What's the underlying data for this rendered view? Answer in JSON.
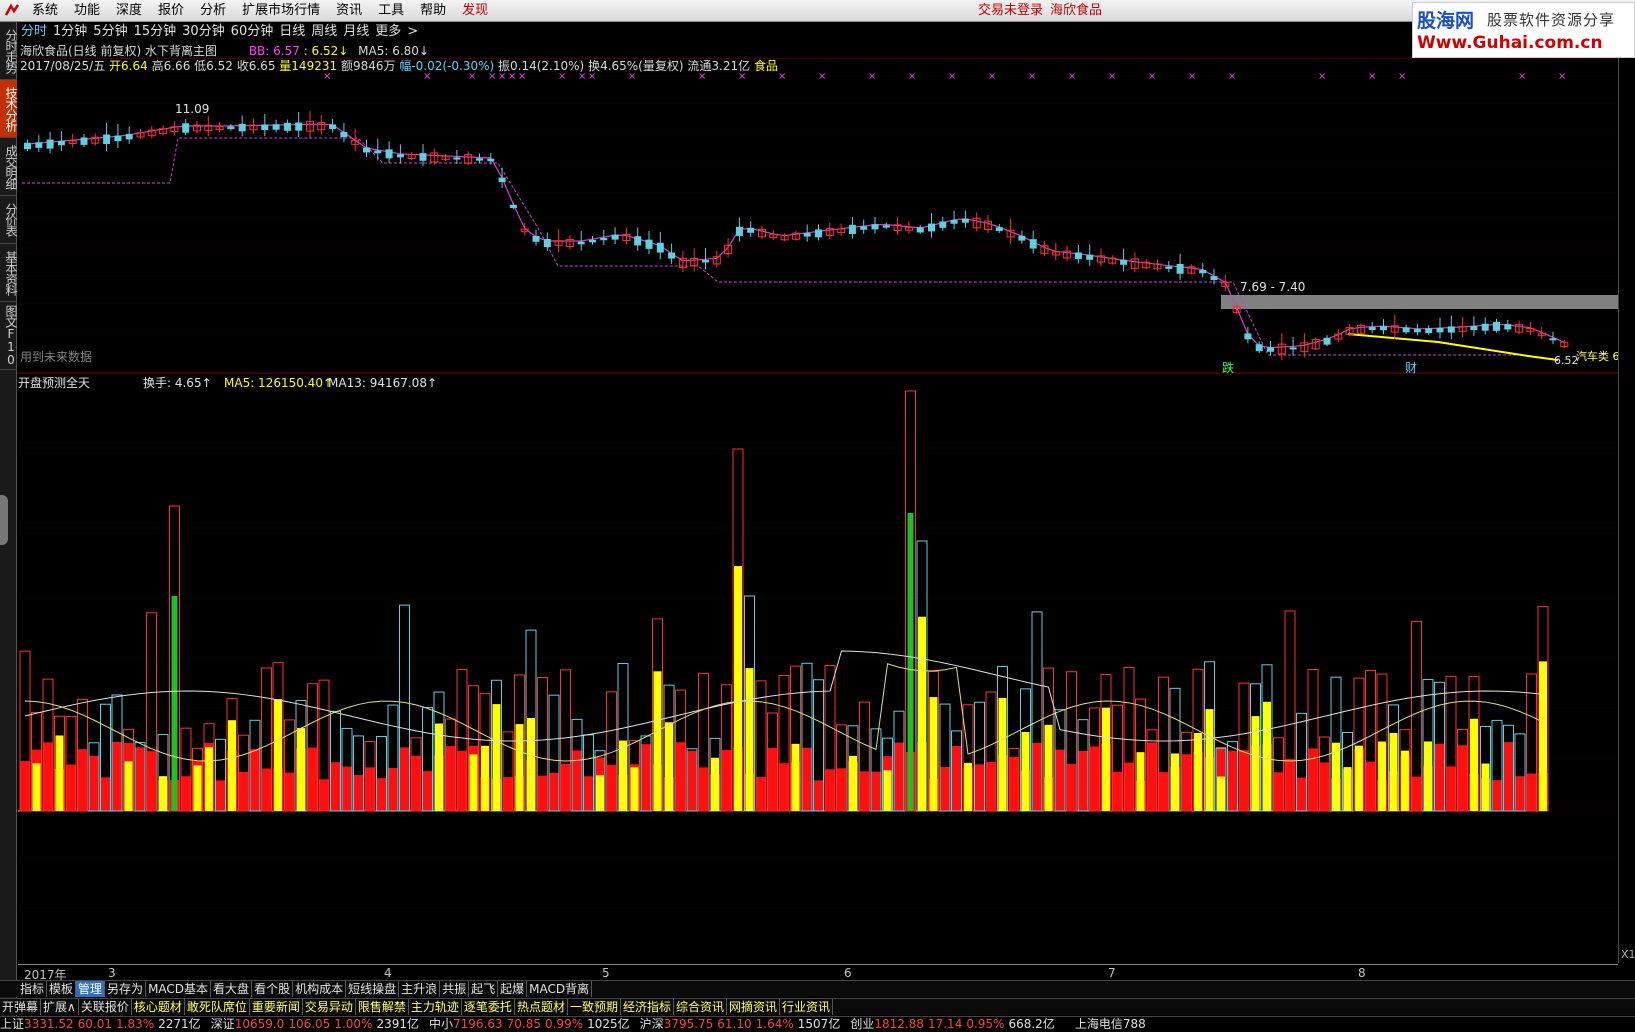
{
  "menu": {
    "items": [
      "系统",
      "功能",
      "深度",
      "报价",
      "分析",
      "扩展市场行情",
      "资讯",
      "工具",
      "帮助",
      "发现"
    ],
    "status": "交易未登录",
    "stock": "海欣食品"
  },
  "brand": {
    "name": "股海网",
    "slogan": "股票软件资源分享",
    "url": "Www.Guhai.com.cn"
  },
  "left_tabs": [
    "分时走势",
    "技术分析",
    "成交明细",
    "分价表",
    "基本资料",
    "图文F10"
  ],
  "periods": [
    "分时",
    "1分钟",
    "5分钟",
    "15分钟",
    "30分钟",
    "60分钟",
    "日线",
    "周线",
    "月线",
    "更多",
    ">"
  ],
  "title_line": {
    "title": "海欣食品(日线 前复权) 水下背离主图",
    "bb": "BB: 6.57",
    "bb2": ": 6.52↓",
    "ma5": "MA5: 6.80↓"
  },
  "quote_line": {
    "date": "2017/08/25/五",
    "open": "开6.64",
    "high": "高6.66",
    "low": "低6.52",
    "close": "收6.65",
    "vol": "量149231",
    "amount": "额9846万",
    "change": "幅-0.02(-0.30%)",
    "amplitude": "振0.14(2.10%)",
    "turnover": "换4.65%(量复权)",
    "float": "流通3.21亿",
    "industry": "食品"
  },
  "main_chart": {
    "high_label": "11.09",
    "range_label": "7.69 - 7.40",
    "low_label": "6.52",
    "sector_label": "汽车类 6",
    "future_note": "用到未来数据",
    "marks": [
      "跌",
      "财"
    ]
  },
  "sub_chart": {
    "title": "开盘预测全天",
    "turnover": "换手: 4.65↑",
    "ma5": "MA5: 126150.40↑",
    "ma13": "MA13: 94167.08↑"
  },
  "date_axis": [
    "2017年",
    "3",
    "4",
    "5",
    "6",
    "7",
    "8"
  ],
  "toolbar1": [
    "指标",
    "模板",
    "管理",
    "另存为",
    "MACD基本",
    "看大盘",
    "看个股",
    "机构成本",
    "短线操盘",
    "主升浪",
    "共振",
    "起飞",
    "起爆",
    "MACD背离"
  ],
  "toolbar1_selected": "管理",
  "toolbar2": [
    "开弹幕",
    "扩展∧",
    "关联报价",
    "核心题材",
    "敢死队席位",
    "重要新闻",
    "交易异动",
    "限售解禁",
    "主力轨迹",
    "逐笔委托",
    "热点题材",
    "一致预期",
    "经济指标",
    "综合资讯",
    "网摘资讯",
    "行业资讯"
  ],
  "ticker": [
    {
      "name": "上证",
      "val": "3331.52",
      "chg": "60.01",
      "pct": "1.83%",
      "amt": "2271亿"
    },
    {
      "name": "深证",
      "val": "10659.0",
      "chg": "106.05",
      "pct": "1.00%",
      "amt": "2391亿"
    },
    {
      "name": "中小",
      "val": "7196.63",
      "chg": "70.85",
      "pct": "0.99%",
      "amt": "1025亿"
    },
    {
      "name": "沪深",
      "val": "3795.75",
      "chg": "61.10",
      "pct": "1.64%",
      "amt": "1507亿"
    },
    {
      "name": "创业",
      "val": "1812.88",
      "chg": "17.14",
      "pct": "0.95%",
      "amt": "668.2亿"
    }
  ],
  "ticker_tail": "上海电信788",
  "colors": {
    "up": "#ff3030",
    "down": "#5fd0e0",
    "ma": "#d040d0",
    "yellow": "#ffff00",
    "green": "#20c020"
  }
}
